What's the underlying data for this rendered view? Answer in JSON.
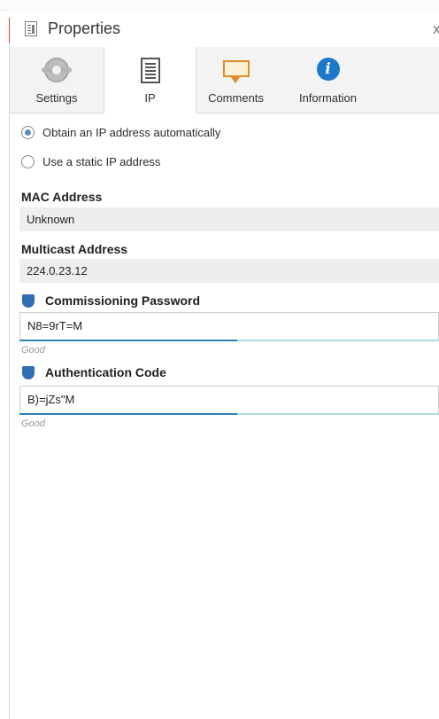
{
  "window": {
    "title": "Properties",
    "close_glyph": "x"
  },
  "tabs": [
    {
      "label": "Settings",
      "icon": "gear-icon",
      "active": false
    },
    {
      "label": "IP",
      "icon": "document-icon",
      "active": true
    },
    {
      "label": "Comments",
      "icon": "comment-icon",
      "active": false
    },
    {
      "label": "Information",
      "icon": "info-icon",
      "active": false
    }
  ],
  "ip": {
    "radio_auto_label": "Obtain an IP address automatically",
    "radio_auto_selected": true,
    "radio_static_label": "Use a static IP address",
    "radio_static_selected": false,
    "mac_label": "MAC Address",
    "mac_value": "Unknown",
    "multicast_label": "Multicast Address",
    "multicast_value": "224.0.23.12",
    "commissioning_label": "Commissioning Password",
    "commissioning_value": "N8=9rT=M",
    "commissioning_strength": "Good",
    "commissioning_strength_fraction": 0.52,
    "auth_label": "Authentication Code",
    "auth_value": "B)=jZs\"M",
    "auth_strength": "Good",
    "auth_strength_fraction": 0.52
  },
  "colors": {
    "accent": "#2a84b8",
    "shield": "#2e6fb6",
    "track": "#a9dbe7"
  }
}
